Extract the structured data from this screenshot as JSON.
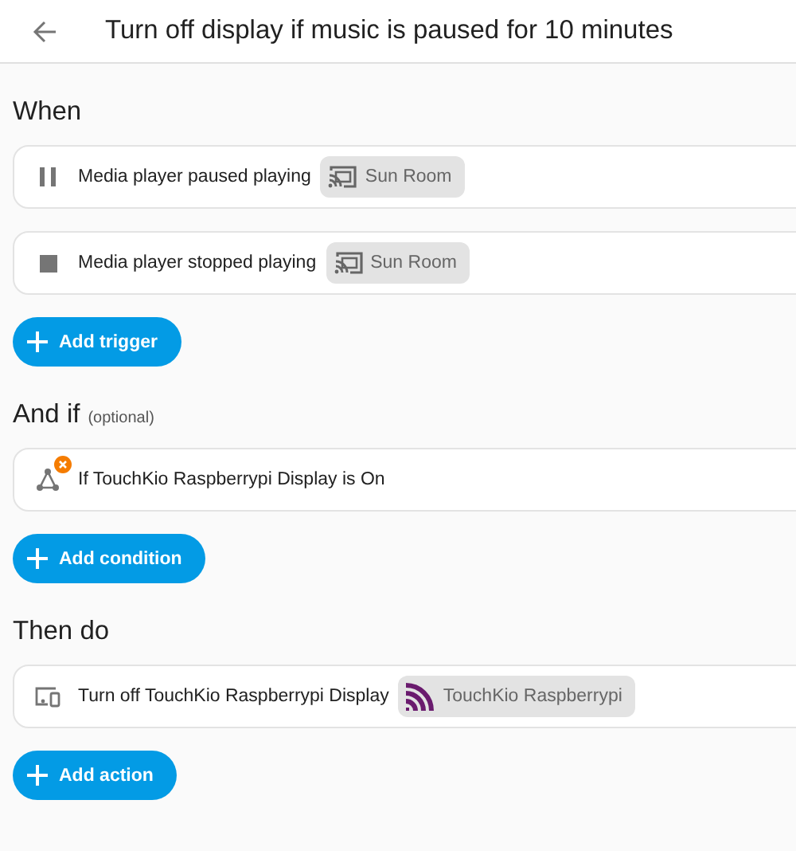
{
  "header": {
    "title": "Turn off display if music is paused for 10 minutes"
  },
  "sections": [
    {
      "title": "When",
      "items": [
        {
          "kind": "pause",
          "text": "Media player paused playing",
          "error": false,
          "chip": {
            "kind": "cast",
            "label": "Sun Room"
          }
        },
        {
          "kind": "stop",
          "text": "Media player stopped playing",
          "error": false,
          "chip": {
            "kind": "cast",
            "label": "Sun Room"
          }
        }
      ],
      "button": "Add trigger"
    },
    {
      "title": "And if",
      "note": "(optional)",
      "items": [
        {
          "kind": "condition",
          "text": "If TouchKio Raspberrypi Display is On",
          "error": true
        }
      ],
      "button": "Add condition"
    },
    {
      "title": "Then do",
      "items": [
        {
          "kind": "device",
          "text": "Turn off TouchKio Raspberrypi Display",
          "error": false,
          "chip": {
            "kind": "brand",
            "label": "TouchKio Raspberrypi"
          }
        }
      ],
      "button": "Add action"
    }
  ]
}
